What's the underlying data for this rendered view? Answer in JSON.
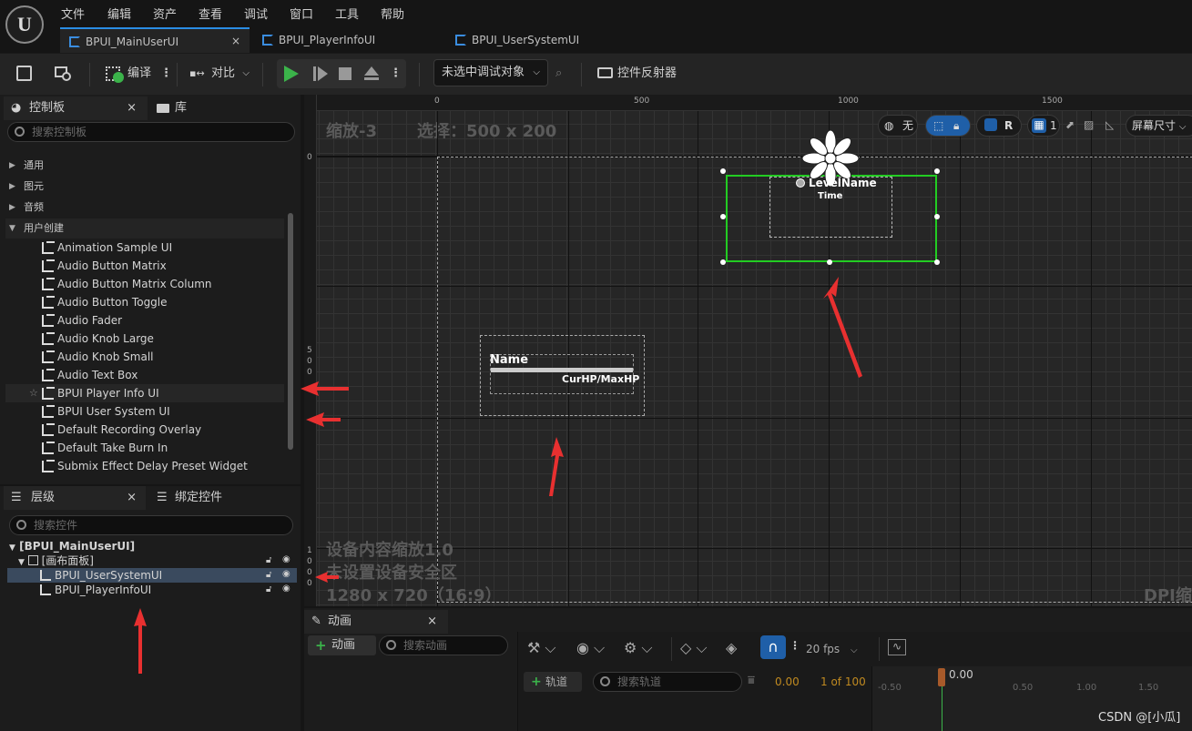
{
  "menu": [
    "文件",
    "编辑",
    "资产",
    "查看",
    "调试",
    "窗口",
    "工具",
    "帮助"
  ],
  "tabs": [
    {
      "label": "BPUI_MainUserUI",
      "close": "×"
    },
    {
      "label": "BPUI_PlayerInfoUI"
    },
    {
      "label": "BPUI_UserSystemUI"
    }
  ],
  "toolbar": {
    "compile": "编译",
    "diff": "对比",
    "debug_target": "未选中调试对象",
    "reflector": "控件反射器"
  },
  "palette": {
    "tab": "控制板",
    "lib_tab": "库",
    "search_placeholder": "搜索控制板",
    "categories": [
      "通用",
      "图元",
      "音频",
      "用户创建"
    ],
    "items": [
      "Animation Sample UI",
      "Audio Button Matrix",
      "Audio Button Matrix Column",
      "Audio Button Toggle",
      "Audio Fader",
      "Audio Knob Large",
      "Audio Knob Small",
      "Audio Text Box",
      "BPUI Player Info UI",
      "BPUI User System UI",
      "Default Recording Overlay",
      "Default Take Burn In",
      "Submix Effect Delay Preset Widget"
    ]
  },
  "hierarchy": {
    "tab": "层级",
    "bind_tab": "绑定控件",
    "search_placeholder": "搜索控件",
    "root": "[BPUI_MainUserUI]",
    "canvas": "[画布面板]",
    "children": [
      "BPUI_UserSystemUI",
      "BPUI_PlayerInfoUI"
    ]
  },
  "designer": {
    "zoom": "缩放-3",
    "selection": "选择：500 x 200",
    "ruler_top": [
      "0",
      "500",
      "1000",
      "1500"
    ],
    "ruler_left": [
      "0",
      "5",
      "0",
      "0",
      "1",
      "0",
      "0",
      "0"
    ],
    "overlay_scale": "设备内容缩放1.0",
    "overlay_safe": "未设置设备安全区",
    "overlay_res": "1280 x 720（16:9）",
    "dpi": "DPI缩",
    "none_btn": "无",
    "r_btn": "R",
    "grid_num": "1",
    "screen_size": "屏幕尺寸",
    "widget_level": "LevelName",
    "widget_time": "Time",
    "widget_name": "Name",
    "widget_hp": "CurHP/MaxHP"
  },
  "animation": {
    "tab": "动画",
    "add_btn": "动画",
    "search_placeholder": "搜索动画",
    "fps": "20 fps",
    "track_btn": "轨道",
    "track_search": "搜索轨道",
    "time": "0.00",
    "frames": "1 of 100",
    "playhead": "0.00",
    "ticks": [
      "-0.50",
      "0.50",
      "1.00",
      "1.50"
    ]
  },
  "watermark": "CSDN @[小瓜]",
  "colors": {
    "accent": "#2a8de4",
    "selection": "#22cc22",
    "arrow": "#e83030"
  }
}
